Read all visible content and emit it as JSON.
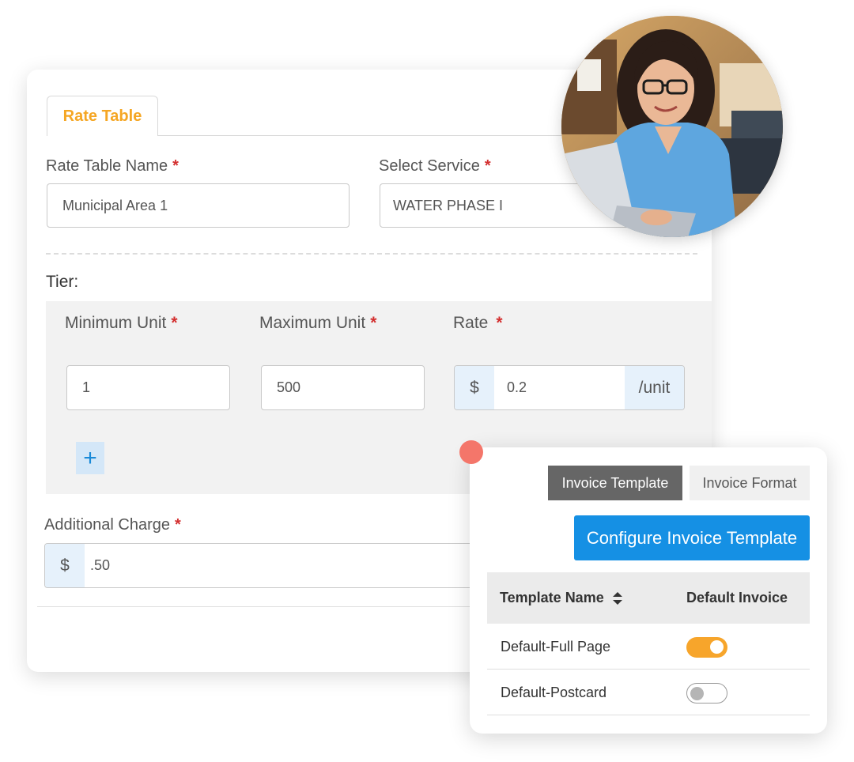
{
  "rate_table": {
    "tab_label": "Rate Table",
    "name_label": "Rate Table Name",
    "name_value": "Municipal Area 1",
    "service_label": "Select Service",
    "service_value": "WATER PHASE I",
    "required_mark": "*",
    "tier_label": "Tier:",
    "tier": {
      "min_label": "Minimum Unit",
      "min_value": "1",
      "max_label": "Maximum Unit",
      "max_value": "500",
      "rate_label": "Rate",
      "rate_prefix": "$",
      "rate_value": "0.2",
      "rate_suffix": "/unit",
      "add_symbol": "+"
    },
    "additional_label": "Additional Charge",
    "additional_prefix": "$",
    "additional_value": ".50"
  },
  "invoice": {
    "tab_template": "Invoice Template",
    "tab_format": "Invoice Format",
    "configure_button": "Configure Invoice Template",
    "columns": [
      "Template Name",
      "Default Invoice"
    ],
    "sort_icon": "sort-icon",
    "rows": [
      {
        "name": "Default-Full Page",
        "default": true
      },
      {
        "name": "Default-Postcard",
        "default": false
      }
    ]
  },
  "colors": {
    "accent_orange": "#f5a623",
    "primary_blue": "#1590e4",
    "required_red": "#d32f2f",
    "dot_red": "#f4766a"
  }
}
